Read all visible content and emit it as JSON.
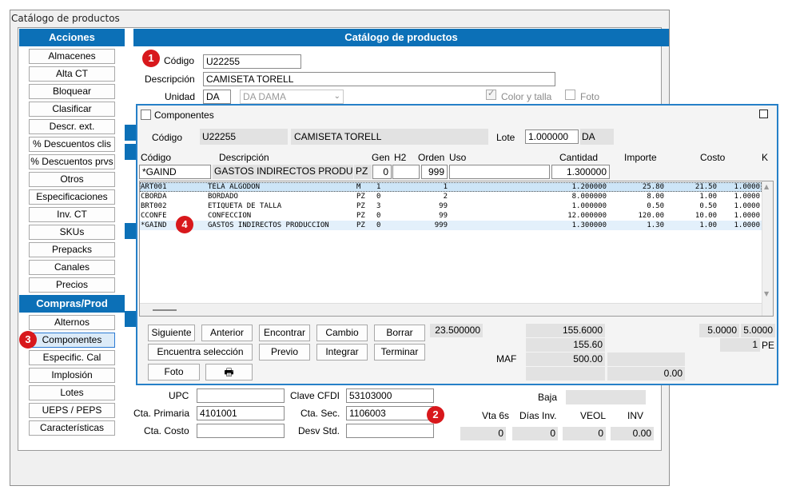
{
  "window": {
    "title": "Catálogo de productos"
  },
  "sidebar": {
    "acciones_header": "Acciones",
    "acciones": [
      "Almacenes",
      "Alta CT",
      "Bloquear",
      "Clasificar",
      "Descr. ext.",
      "% Descuentos clis",
      "% Descuentos prvs",
      "Otros",
      "Especificaciones",
      "Inv. CT",
      "SKUs",
      "Prepacks",
      "Canales",
      "Precios"
    ],
    "compras_header": "Compras/Prod",
    "compras": [
      "Alternos",
      "Componentes",
      "Especific. Cal",
      "Implosión",
      "Lotes",
      "UEPS / PEPS",
      "Características"
    ]
  },
  "main": {
    "header": "Catálogo de productos",
    "codigo_label": "Código",
    "codigo_value": "U22255",
    "descripcion_label": "Descripción",
    "descripcion_value": "CAMISETA TORELL",
    "unidad_label": "Unidad",
    "unidad_value": "DA",
    "unidad_select": "DA  DAMA",
    "color_talla_label": "Color y talla",
    "color_talla_checked": true,
    "foto_label": "Foto",
    "upc_label": "UPC",
    "upc_value": "",
    "clave_cfdi_label": "Clave CFDI",
    "clave_cfdi_value": "53103000",
    "baja_label": "Baja",
    "baja_value": "",
    "cta_primaria_label": "Cta. Primaria",
    "cta_primaria_value": "4101001",
    "cta_sec_label": "Cta. Sec.",
    "cta_sec_value": "1106003",
    "cta_costo_label": "Cta. Costo",
    "cta_costo_value": "",
    "desv_std_label": "Desv Std.",
    "desv_std_value": "",
    "stats_headers": [
      "Vta 6s",
      "Días Inv.",
      "VEOL",
      "INV"
    ],
    "stats_values": [
      "0",
      "0",
      "0",
      "0.00"
    ]
  },
  "popup": {
    "title": "Componentes",
    "codigo_label": "Código",
    "codigo_value": "U22255",
    "descripcion_value": "CAMISETA TORELL",
    "lote_label": "Lote",
    "lote_value": "1.000000",
    "lote_unit": "DA",
    "col_headers": {
      "codigo": "Código",
      "descripcion": "Descripción",
      "gen": "Gen",
      "h2": "H2",
      "orden": "Orden",
      "uso": "Uso",
      "cantidad": "Cantidad",
      "importe": "Importe",
      "costo": "Costo",
      "k": "K"
    },
    "edit_row": {
      "codigo": "*GAIND",
      "descripcion": "GASTOS INDIRECTOS PRODUCCI",
      "unidad": "PZ",
      "gen": "0",
      "h2": "",
      "orden": "999",
      "uso": "",
      "cantidad": "1.300000"
    },
    "rows": [
      {
        "codigo": "ART001",
        "descripcion": "TELA ALGODON",
        "unidad": "M",
        "gen": "1",
        "orden": "1",
        "cantidad": "1.200000",
        "importe": "25.80",
        "costo": "21.50",
        "k": "1.0000"
      },
      {
        "codigo": "CBORDA",
        "descripcion": "BORDADO",
        "unidad": "PZ",
        "gen": "0",
        "orden": "2",
        "cantidad": "8.000000",
        "importe": "8.00",
        "costo": "1.00",
        "k": "1.0000"
      },
      {
        "codigo": "BRT002",
        "descripcion": "ETIQUETA DE TALLA",
        "unidad": "PZ",
        "gen": "3",
        "orden": "99",
        "cantidad": "1.000000",
        "importe": "0.50",
        "costo": "0.50",
        "k": "1.0000"
      },
      {
        "codigo": "CCONFE",
        "descripcion": "CONFECCION",
        "unidad": "PZ",
        "gen": "0",
        "orden": "99",
        "cantidad": "12.000000",
        "importe": "120.00",
        "costo": "10.00",
        "k": "1.0000"
      },
      {
        "codigo": "*GAIND",
        "descripcion": "GASTOS INDIRECTOS PRODUCCION",
        "unidad": "PZ",
        "gen": "0",
        "orden": "999",
        "cantidad": "1.300000",
        "importe": "1.30",
        "costo": "1.00",
        "k": "1.0000"
      }
    ],
    "buttons": {
      "siguiente": "Siguiente",
      "anterior": "Anterior",
      "encontrar": "Encontrar",
      "cambio": "Cambio",
      "borrar": "Borrar",
      "encuentra_seleccion": "Encuentra selección",
      "previo": "Previo",
      "integrar": "Integrar",
      "terminar": "Terminar",
      "foto": "Foto"
    },
    "total_cantidad": "23.500000",
    "total_importe": "155.6000",
    "total_importe2": "155.60",
    "maf_label": "MAF",
    "maf_value": "500.00",
    "right_value": "0.00",
    "k1": "5.0000",
    "k2": "5.0000",
    "pe_value": "1",
    "pe_label": "PE"
  },
  "badges": [
    "1",
    "2",
    "3",
    "4"
  ]
}
